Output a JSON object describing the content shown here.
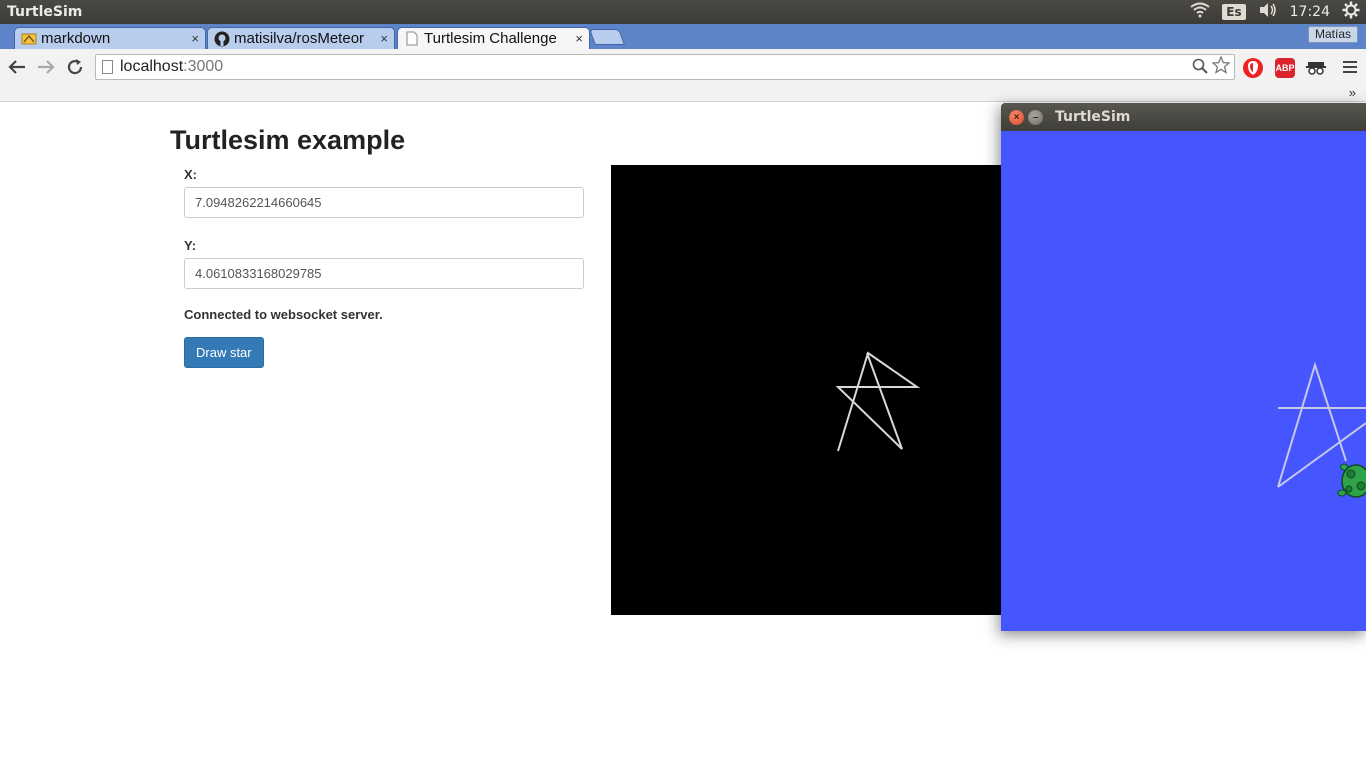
{
  "panel": {
    "app_title": "TurtleSim",
    "keyboard_layout": "Es",
    "clock": "17:24"
  },
  "browser": {
    "tabs": [
      {
        "label": "markdown",
        "icon": "markdown-favicon",
        "active": false
      },
      {
        "label": "matisilva/rosMeteor",
        "icon": "github-icon",
        "active": false
      },
      {
        "label": "Turtlesim Challenge",
        "icon": "page-icon",
        "active": true
      }
    ],
    "close_glyph": "×",
    "profile_name": "Matías",
    "url_host": "localhost",
    "url_port": ":3000",
    "bookmarks_more": "»"
  },
  "page": {
    "title": "Turtlesim example",
    "x_label": "X:",
    "x_value": "7.0948262214660645",
    "y_label": "Y:",
    "y_value": "4.0610833168029785",
    "status": "Connected to websocket server.",
    "draw_button": "Draw star"
  },
  "turtlesim_window": {
    "title": "TurtleSim",
    "background_color": "#4556ff"
  },
  "colors": {
    "accent_button": "#337ab7",
    "panel": "#3c3b37",
    "tab_strip": "#5d84c9"
  }
}
